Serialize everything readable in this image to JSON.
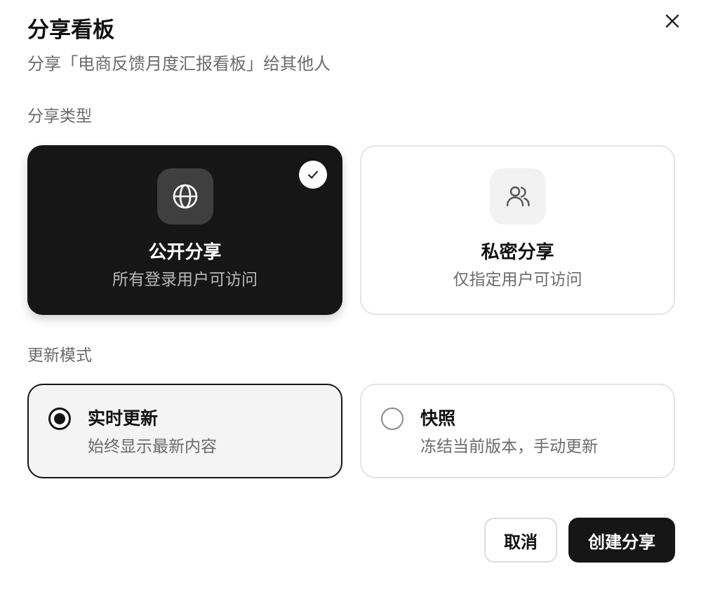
{
  "dialog": {
    "title": "分享看板",
    "subtitle": "分享「电商反馈月度汇报看板」给其他人"
  },
  "share_type": {
    "label": "分享类型",
    "options": [
      {
        "name": "公开分享",
        "desc": "所有登录用户可访问",
        "icon": "globe-icon",
        "selected": true
      },
      {
        "name": "私密分享",
        "desc": "仅指定用户可访问",
        "icon": "users-icon",
        "selected": false
      }
    ]
  },
  "update_mode": {
    "label": "更新模式",
    "options": [
      {
        "name": "实时更新",
        "desc": "始终显示最新内容",
        "selected": true
      },
      {
        "name": "快照",
        "desc": "冻结当前版本，手动更新",
        "selected": false
      }
    ]
  },
  "actions": {
    "cancel_label": "取消",
    "create_label": "创建分享"
  },
  "icons": {
    "close": "close-icon",
    "check": "check-icon"
  },
  "colors": {
    "primary": "#161616",
    "selected_icon_bg": "#3f3f3f",
    "border": "#e4e4e4",
    "muted_text": "#6b6b6b"
  }
}
